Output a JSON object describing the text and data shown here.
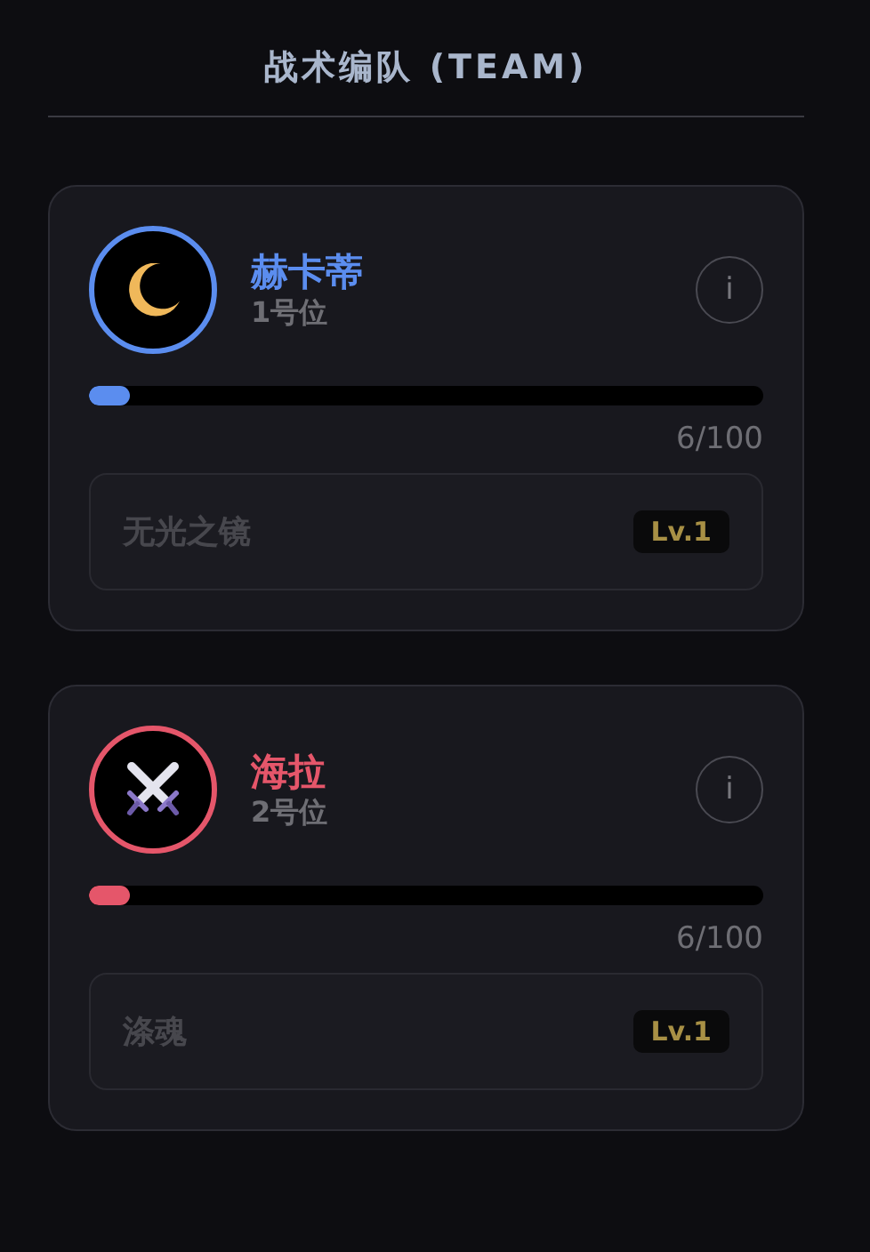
{
  "title": "战术编队 (TEAM)",
  "members": [
    {
      "name": "赫卡蒂",
      "slot": "1号位",
      "color": "#5b8def",
      "avatar": {
        "kind": "moon"
      },
      "info": "i",
      "level": 0.06,
      "reading": "6/100",
      "equipment": {
        "name": "无光之镜",
        "badge": "Lv.1"
      }
    },
    {
      "name": "海拉",
      "slot": "2号位",
      "color": "#e5566a",
      "avatar": {
        "kind": "swords"
      },
      "info": "i",
      "level": 0.06,
      "reading": "6/100",
      "equipment": {
        "name": "涤魂",
        "badge": "Lv.1"
      }
    }
  ]
}
